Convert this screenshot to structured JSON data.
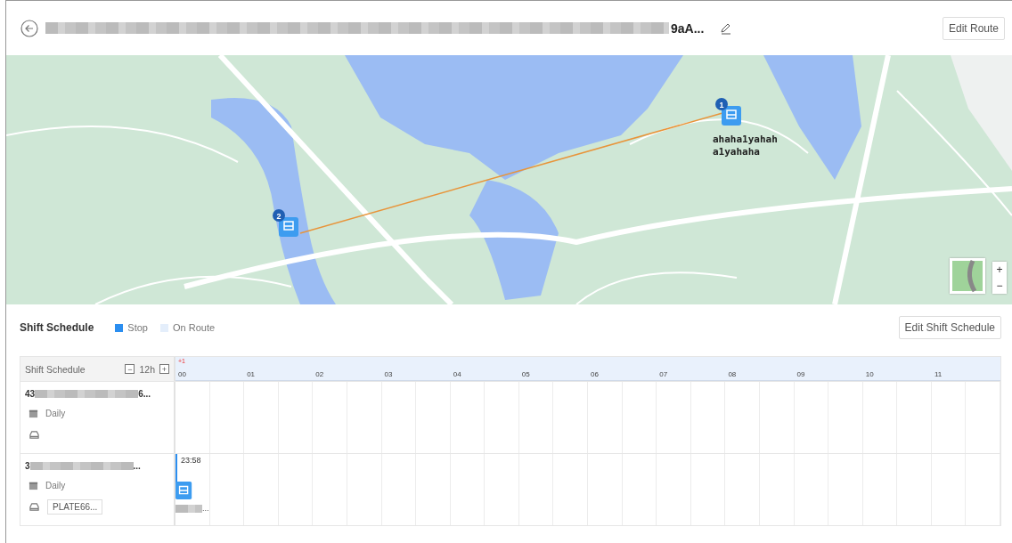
{
  "header": {
    "title_tail": "9aA...",
    "button": "Edit Route"
  },
  "map": {
    "stops": [
      {
        "number": "1",
        "label_lines": [
          "ahaha1yahah",
          "a1yahaha"
        ]
      },
      {
        "number": "2"
      }
    ],
    "zoom_in": "+",
    "zoom_out": "−"
  },
  "schedule": {
    "title": "Shift Schedule",
    "legend": [
      {
        "label": "Stop",
        "color": "#2b8ef0"
      },
      {
        "label": "On Route",
        "color": "#e4eefb"
      }
    ],
    "button": "Edit Shift Schedule",
    "column_title": "Shift Schedule",
    "zoom_minus": "−",
    "zoom_level": "12h",
    "zoom_plus": "+",
    "day_offset": "+1",
    "hours": [
      "00",
      "01",
      "02",
      "03",
      "04",
      "05",
      "06",
      "07",
      "08",
      "09",
      "10",
      "11"
    ],
    "rows": [
      {
        "name_start": "43",
        "name_end": "6...",
        "repeat": "Daily"
      },
      {
        "name_start": "3",
        "name_end": "...",
        "repeat": "Daily",
        "plate": "PLATE66...",
        "stop_time": "23:58",
        "stop_label": "..."
      }
    ]
  }
}
